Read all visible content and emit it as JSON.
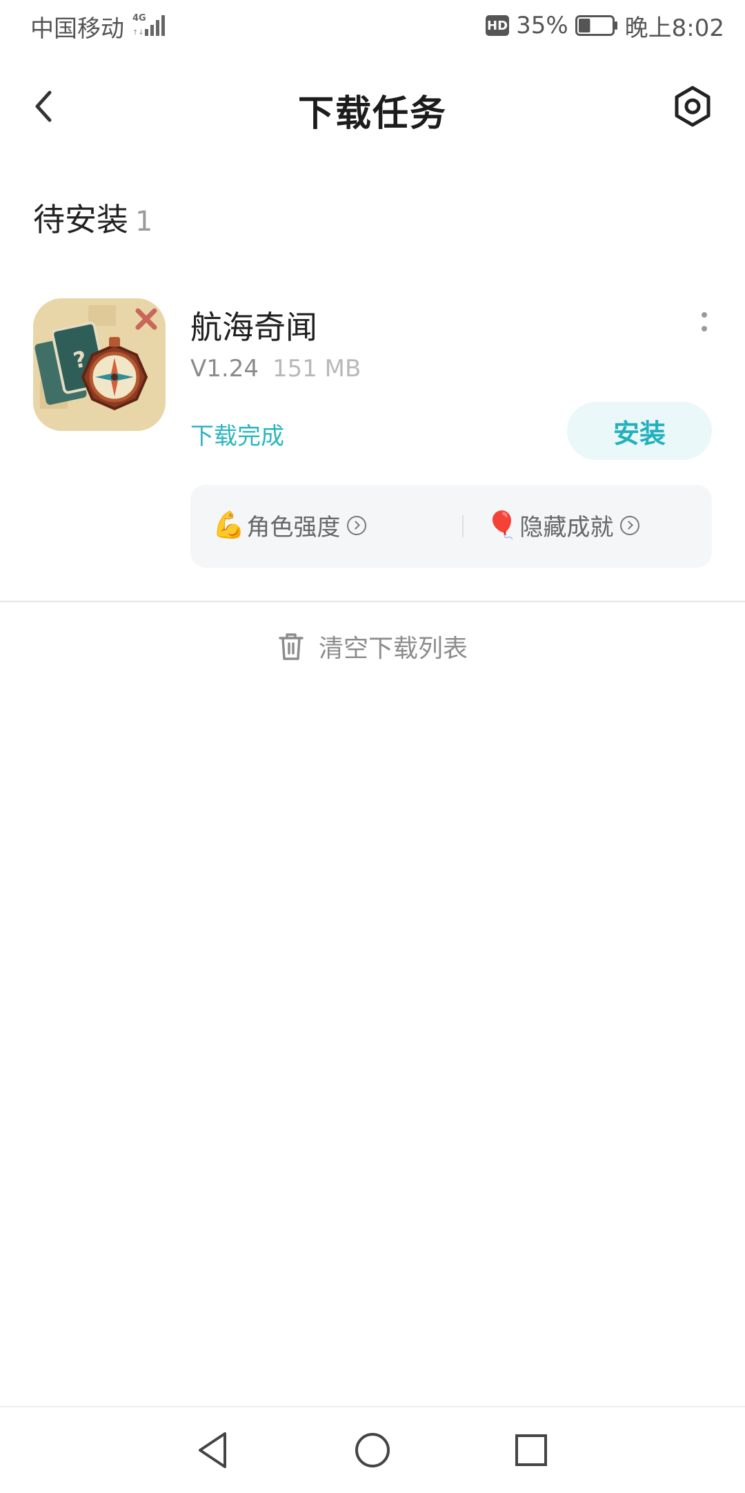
{
  "status_bar": {
    "carrier": "中国移动",
    "network": "4G",
    "hd_badge": "HD",
    "battery_percent": "35%",
    "battery_level": 0.35,
    "time": "晚上8:02"
  },
  "header": {
    "title": "下载任务",
    "back_icon": "back-chevron-icon",
    "settings_icon": "settings-icon"
  },
  "section": {
    "title": "待安装",
    "count": "1"
  },
  "app": {
    "name": "航海奇闻",
    "version": "V1.24",
    "size": "151 MB",
    "status": "下载完成",
    "install_label": "安装",
    "tags": [
      {
        "emoji": "💪",
        "label": "角色强度"
      },
      {
        "emoji": "🎈",
        "label": "隐藏成就"
      }
    ]
  },
  "clear": {
    "label": "清空下载列表",
    "icon": "trash-icon"
  },
  "colors": {
    "accent": "#2bb5c0",
    "install_bg": "#eaf8f9",
    "tag_bg": "#f5f6f8"
  }
}
